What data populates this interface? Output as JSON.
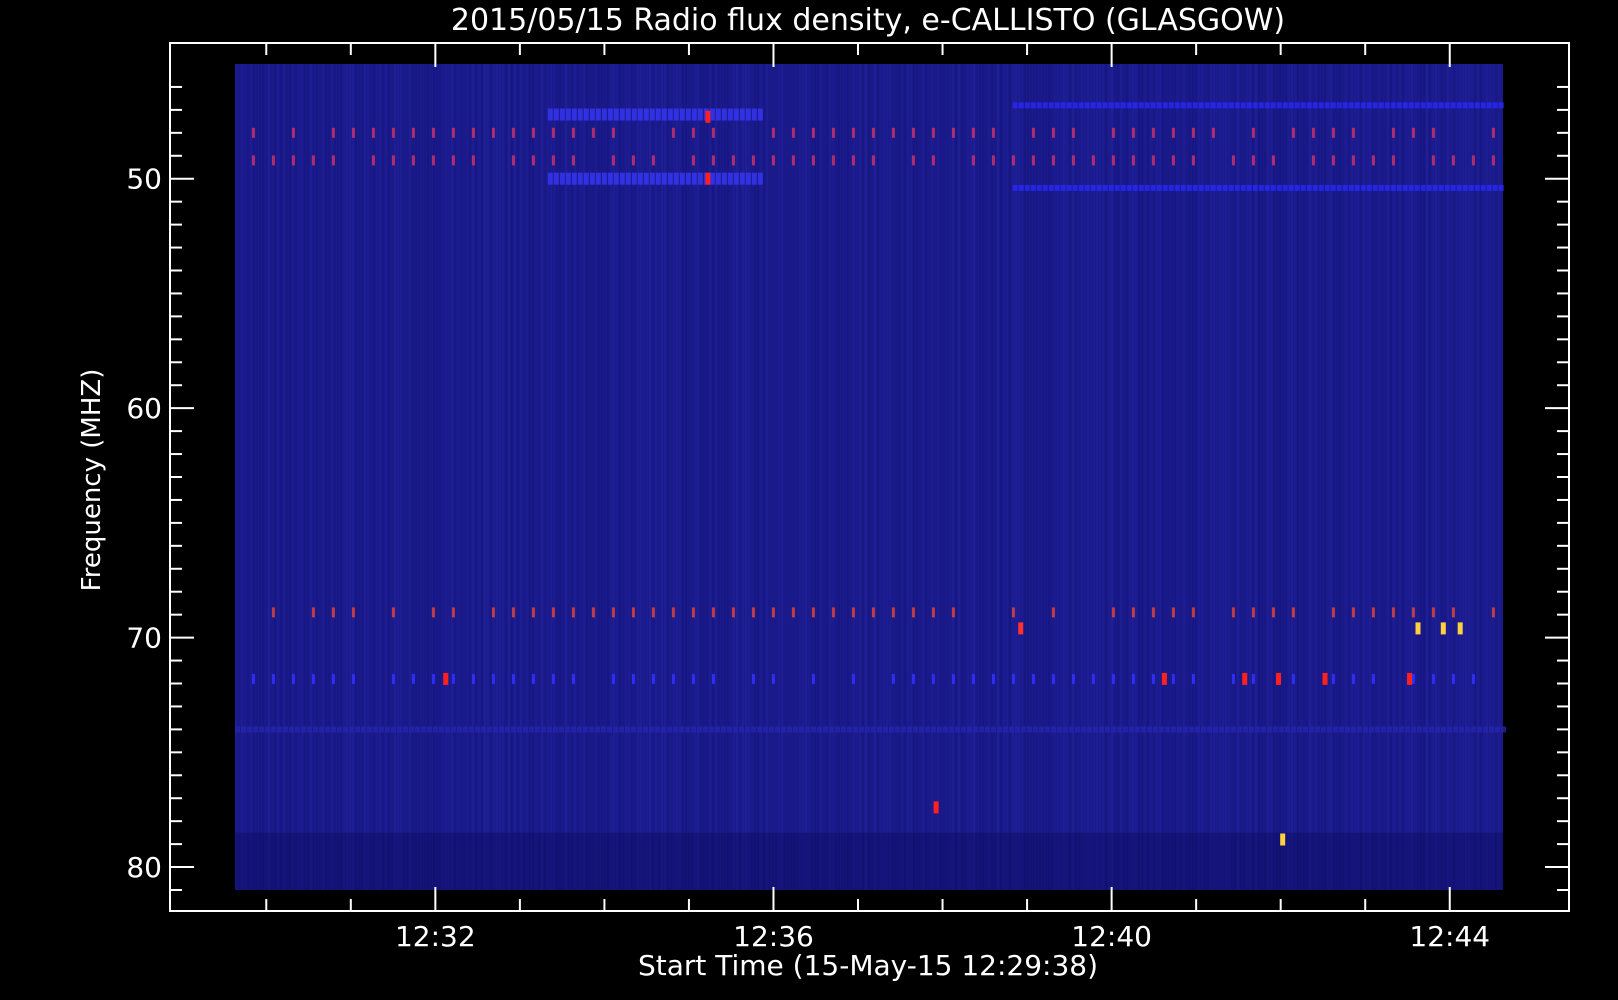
{
  "chart_data": {
    "type": "heatmap",
    "title": "2015/05/15  Radio flux density, e-CALLISTO (GLASGOW)",
    "xlabel": "Start Time (15-May-15 12:29:38)",
    "ylabel": "Frequency (MHZ)",
    "x_tick_labels": [
      "12:32",
      "12:36",
      "12:40",
      "12:44"
    ],
    "x_tick_minutes": [
      2.37,
      6.37,
      10.37,
      14.37
    ],
    "y_ticks": [
      50,
      60,
      70,
      80
    ],
    "ylim": [
      45,
      81
    ],
    "data_time_range_minutes": [
      0,
      15
    ],
    "data_freq_range_mhz": [
      45,
      81
    ],
    "background_color": "#1a1a8c",
    "axis_color": "#ffffff",
    "features": [
      {
        "name": "interference-band",
        "freq_mhz": 48.0,
        "t_start": 0.2,
        "t_end": 15.0,
        "color": "#c0306a"
      },
      {
        "name": "interference-band",
        "freq_mhz": 49.2,
        "t_start": 0.2,
        "t_end": 15.0,
        "color": "#c0306a"
      },
      {
        "name": "bright-patch",
        "freq_mhz": 47.2,
        "t_start": 3.7,
        "t_end": 6.2,
        "color": "#3a3aff"
      },
      {
        "name": "bright-patch",
        "freq_mhz": 50.0,
        "t_start": 3.7,
        "t_end": 6.2,
        "color": "#3a3aff"
      },
      {
        "name": "blue-band",
        "freq_mhz": 46.8,
        "t_start": 9.2,
        "t_end": 15.0,
        "color": "#2a2aff"
      },
      {
        "name": "blue-band",
        "freq_mhz": 50.4,
        "t_start": 9.2,
        "t_end": 15.0,
        "color": "#2a2aff"
      },
      {
        "name": "sparse-band",
        "freq_mhz": 68.9,
        "t_start": 0.2,
        "t_end": 15.0,
        "color": "#d04040"
      },
      {
        "name": "sparse-band",
        "freq_mhz": 71.8,
        "t_start": 0.2,
        "t_end": 15.0,
        "color": "#3030ff"
      },
      {
        "name": "faint-band",
        "freq_mhz": 74.0,
        "t_start": 0.0,
        "t_end": 15.0,
        "color": "#2626b0"
      }
    ],
    "hot_spots": [
      {
        "t": 2.5,
        "freq_mhz": 71.8,
        "color": "#ff2020"
      },
      {
        "t": 8.3,
        "freq_mhz": 77.4,
        "color": "#ff2020"
      },
      {
        "t": 9.3,
        "freq_mhz": 69.6,
        "color": "#ff3030"
      },
      {
        "t": 11.0,
        "freq_mhz": 71.8,
        "color": "#ff2020"
      },
      {
        "t": 11.95,
        "freq_mhz": 71.8,
        "color": "#ff2020"
      },
      {
        "t": 12.35,
        "freq_mhz": 71.8,
        "color": "#ff2020"
      },
      {
        "t": 12.9,
        "freq_mhz": 71.8,
        "color": "#ff2020"
      },
      {
        "t": 13.9,
        "freq_mhz": 71.8,
        "color": "#ff2020"
      },
      {
        "t": 14.0,
        "freq_mhz": 69.6,
        "color": "#ffd040"
      },
      {
        "t": 14.3,
        "freq_mhz": 69.6,
        "color": "#ffd040"
      },
      {
        "t": 14.5,
        "freq_mhz": 69.6,
        "color": "#ffd040"
      },
      {
        "t": 12.4,
        "freq_mhz": 78.8,
        "color": "#ffd040"
      },
      {
        "t": 5.6,
        "freq_mhz": 50.0,
        "color": "#ff2020"
      },
      {
        "t": 5.6,
        "freq_mhz": 47.3,
        "color": "#ff2020"
      }
    ]
  }
}
